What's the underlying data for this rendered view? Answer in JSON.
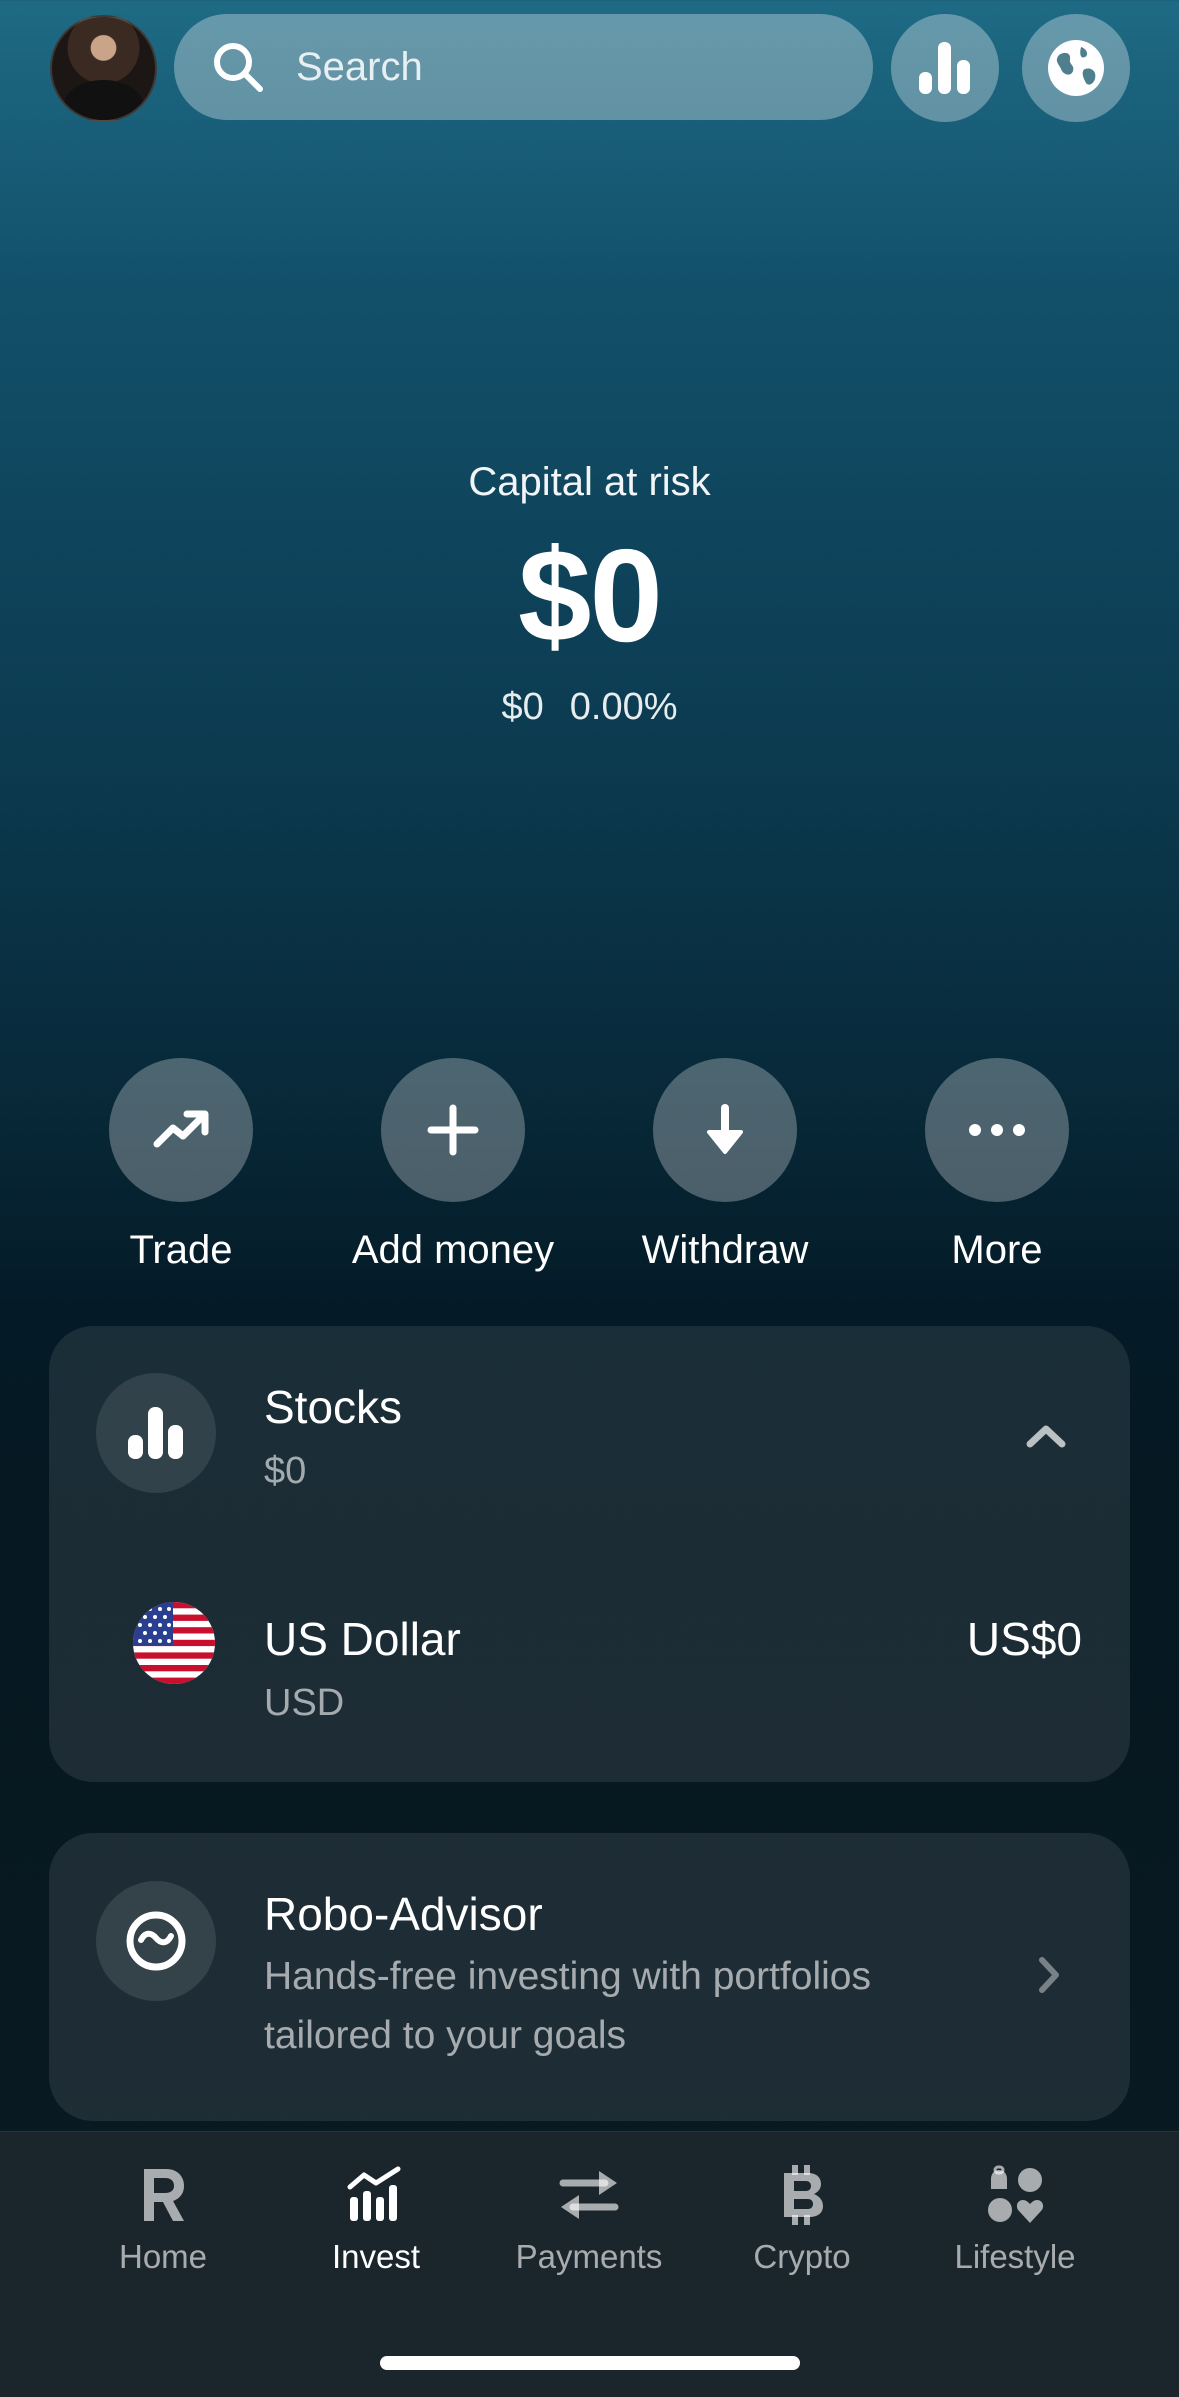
{
  "search": {
    "placeholder": "Search"
  },
  "portfolio": {
    "label": "Capital at risk",
    "amount": "$0",
    "change_amount": "$0",
    "change_percent": "0.00%"
  },
  "actions": [
    {
      "label": "Trade",
      "icon": "trending-up-icon"
    },
    {
      "label": "Add money",
      "icon": "plus-icon"
    },
    {
      "label": "Withdraw",
      "icon": "arrow-down-icon"
    },
    {
      "label": "More",
      "icon": "more-icon"
    }
  ],
  "stocks": {
    "title": "Stocks",
    "value": "$0",
    "currency_name": "US Dollar",
    "currency_code": "USD",
    "currency_value": "US$0"
  },
  "robo": {
    "title": "Robo-Advisor",
    "description_line1": "Hands-free investing with portfolios",
    "description_line2": "tailored to your goals"
  },
  "nav": [
    {
      "label": "Home",
      "icon": "revolut-logo-icon",
      "active": false
    },
    {
      "label": "Invest",
      "icon": "invest-chart-icon",
      "active": true
    },
    {
      "label": "Payments",
      "icon": "transfer-arrows-icon",
      "active": false
    },
    {
      "label": "Crypto",
      "icon": "bitcoin-icon",
      "active": false
    },
    {
      "label": "Lifestyle",
      "icon": "lifestyle-icon",
      "active": false
    }
  ]
}
